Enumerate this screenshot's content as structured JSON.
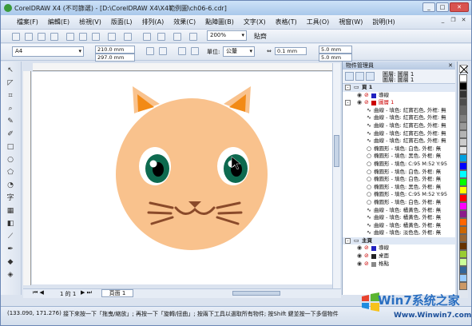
{
  "window": {
    "title": "CorelDRAW X4 (不可篩選) - [D:\\CorelDRAW X4\\X4範例圖\\ch06-6.cdr]",
    "minimize": "_",
    "maximize": "□",
    "close": "✕"
  },
  "menu": [
    "檔案(F)",
    "編輯(E)",
    "檢視(V)",
    "版面(L)",
    "排列(A)",
    "效果(C)",
    "點陣圖(B)",
    "文字(X)",
    "表格(T)",
    "工具(O)",
    "視窗(W)",
    "說明(H)"
  ],
  "toolbar": {
    "zoom": "200%",
    "snap_label": "貼齊"
  },
  "property_bar": {
    "page_size": "A4",
    "width": "210.0 mm",
    "height": "297.0 mm",
    "unit_label": "單位:",
    "unit": "公釐",
    "nudge": "0.1 mm",
    "dup_x": "5.0 mm",
    "dup_y": "5.0 mm"
  },
  "document": {
    "page_counter": "1 的 1",
    "page_tab": "頁面 1"
  },
  "object_manager": {
    "title": "物件管理員",
    "layer_label": "圖層:",
    "layer_value": "圖層 1",
    "layer2_label": "圖層:",
    "layer2_value": "圖層 1",
    "rows": [
      {
        "text": "頁 1",
        "head": true,
        "expand": "-"
      },
      {
        "text": "導線",
        "color": "#2020c0",
        "indent": 18
      },
      {
        "text": "圖層 1",
        "color": "#c00",
        "indent": 18,
        "red": true,
        "expand": "-"
      },
      {
        "text": "曲線 - 填色: 紅寶石色, 外框: 無",
        "indent": 30
      },
      {
        "text": "曲線 - 填色: 紅寶石色, 外框: 無",
        "indent": 30
      },
      {
        "text": "曲線 - 填色: 紅寶石色, 外框: 無",
        "indent": 30
      },
      {
        "text": "曲線 - 填色: 紅寶石色, 外框: 無",
        "indent": 30
      },
      {
        "text": "曲線 - 填色: 紅寶石色, 外框: 無",
        "indent": 30
      },
      {
        "text": "橢圓形 - 填色: 白色, 外框: 無",
        "indent": 30
      },
      {
        "text": "橢圓形 - 填色: 黑色, 外框: 無",
        "indent": 30
      },
      {
        "text": "橢圓形 - 填色: C:95 M:52 Y:95",
        "indent": 30
      },
      {
        "text": "橢圓形 - 填色: 白色, 外框: 無",
        "indent": 30
      },
      {
        "text": "橢圓形 - 填色: 白色, 外框: 無",
        "indent": 30
      },
      {
        "text": "橢圓形 - 填色: 黑色, 外框: 無",
        "indent": 30
      },
      {
        "text": "橢圓形 - 填色: C:95 M:52 Y:95",
        "indent": 30
      },
      {
        "text": "橢圓形 - 填色: 白色, 外框: 無",
        "indent": 30
      },
      {
        "text": "曲線 - 填色: 橘黃色, 外框: 無",
        "indent": 30
      },
      {
        "text": "曲線 - 填色: 橘黃色, 外框: 無",
        "indent": 30
      },
      {
        "text": "曲線 - 填色: 橘黃色, 外框: 無",
        "indent": 30
      },
      {
        "text": "曲線 - 填色: 淡色色, 外框: 無",
        "indent": 30
      },
      {
        "text": "主頁",
        "head": true,
        "expand": "-"
      },
      {
        "text": "導線",
        "color": "#2020c0",
        "indent": 18
      },
      {
        "text": "桌面",
        "color": "#222",
        "indent": 18
      },
      {
        "text": "格點",
        "color": "#888",
        "indent": 18
      }
    ]
  },
  "palette": [
    "#ffffff",
    "#000000",
    "#333333",
    "#4d4d4d",
    "#666666",
    "#808080",
    "#999999",
    "#b3b3b3",
    "#cccccc",
    "#e5e5e5",
    "#00a0e0",
    "#0000ff",
    "#00ffff",
    "#00ff00",
    "#ffff00",
    "#ff0000",
    "#ff00ff",
    "#8b1a8b",
    "#ff6600",
    "#cc6600",
    "#996633",
    "#663300",
    "#99cc33",
    "#ccff99",
    "#336699",
    "#99ccff",
    "#cc9966"
  ],
  "illustration": {
    "face": "#f9c28d",
    "ear_inner": "#f28a16",
    "eye_iris": "#0e6a4f",
    "whisker": "#8a4a2a",
    "nose": "#8a4a2a"
  },
  "status": {
    "coord": "(133.090, 171.276)",
    "hint": "接下來按一下「拖曳/縮放」; 再按一下「旋轉/扭曲」; 按兩下工具以選取所有物件; 按Shift 鍵並按一下多個物件"
  },
  "watermark": {
    "brand": "Win7系统之家",
    "url": "Www.Winwin7.com"
  }
}
